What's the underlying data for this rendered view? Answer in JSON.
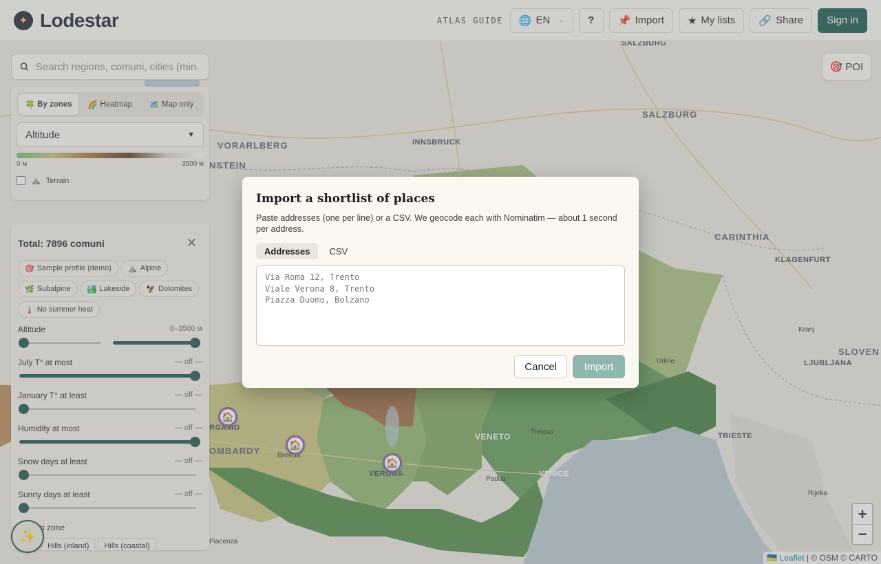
{
  "app": {
    "name": "Lodestar",
    "logo_glyph": "✦",
    "atlas_guide": "ATLAS GUIDE",
    "language": "EN"
  },
  "header": {
    "help_label": "?",
    "import_label": "Import",
    "my_lists_label": "My lists",
    "share_label": "Share",
    "sign_in_label": "Sign in"
  },
  "search": {
    "placeholder": "Search regions, comuni, cities (min."
  },
  "modes": {
    "tabs": [
      {
        "icon": "🍀",
        "label": "By zones",
        "active": true
      },
      {
        "icon": "🌈",
        "label": "Heatmap",
        "active": false
      },
      {
        "icon": "🗺️",
        "label": "Map only",
        "active": false
      }
    ],
    "metric": "Altitude",
    "scale_min": "0 м",
    "scale_max": "3500 м",
    "terrain_label": "Terrain"
  },
  "filters": {
    "total": "Total: 7896 comuni",
    "chips": [
      {
        "icon": "🎯",
        "label": "Sample profile (demo)"
      },
      {
        "icon": "⛰️",
        "label": "Alpine"
      },
      {
        "icon": "🌿",
        "label": "Subalpine"
      },
      {
        "icon": "🏞️",
        "label": "Lakeside"
      },
      {
        "icon": "🦅",
        "label": "Dolomites"
      },
      {
        "icon": "🌡️",
        "label": "No summer heat"
      }
    ],
    "sliders": [
      {
        "label": "Altitude",
        "value": "0–3500 м"
      },
      {
        "label": "July T° at most",
        "value": "— off —"
      },
      {
        "label": "January T° at least",
        "value": "— off —"
      },
      {
        "label": "Humidity at most",
        "value": "— off —"
      },
      {
        "label": "Snow days at least",
        "value": "— off —"
      },
      {
        "label": "Sunny days at least",
        "value": "— off —"
      }
    ],
    "zone_label": "n zone",
    "zone_chips": [
      "ls",
      "Hills (inland)",
      "Hills (coastal)"
    ]
  },
  "map": {
    "poi_label": "POI",
    "labels": {
      "salzburg_small": "SALZBURG",
      "salzburg_big": "SALZBURG",
      "vorarlberg": "VORARLBERG",
      "nstein": "NSTEIN",
      "innsbruck": "INNSBRUCK",
      "carinthia": "CARINTHIA",
      "klagenfurt": "KLAGENFURT",
      "kranj": "Kranj",
      "udine": "Udine",
      "ljubljana": "LJUBLJANA",
      "slovenia": "SLOVEN",
      "trieste": "TRIESTE",
      "rijeka": "Rijeka",
      "veneto": "VENETO",
      "treviso": "Treviso",
      "padua": "Padua",
      "venice": "VENICE",
      "verona": "VERONA",
      "brescia": "Brescia",
      "bergamo": "RGAMO",
      "lombardy": "OMBARDY",
      "piacenza": "Piacenza"
    },
    "zoom_in": "+",
    "zoom_out": "−",
    "attribution_flag": "🇺🇦",
    "attribution_link": "Leaflet",
    "attribution_rest": "| © OSM © CARTO"
  },
  "modal": {
    "title": "Import a shortlist of places",
    "description": "Paste addresses (one per line) or a CSV. We geocode each with Nominatim — about 1 second per address.",
    "tabs": [
      {
        "label": "Addresses",
        "active": true
      },
      {
        "label": "CSV",
        "active": false
      }
    ],
    "textarea_placeholder": "Via Roma 12, Trento\nViale Verona 8, Trento\nPiazza Duomo, Bolzano",
    "cancel_label": "Cancel",
    "import_label": "Import"
  },
  "colors": {
    "brand": "#15584d",
    "accent": "#1d5248",
    "import_disabled": "#8eb7ad"
  }
}
